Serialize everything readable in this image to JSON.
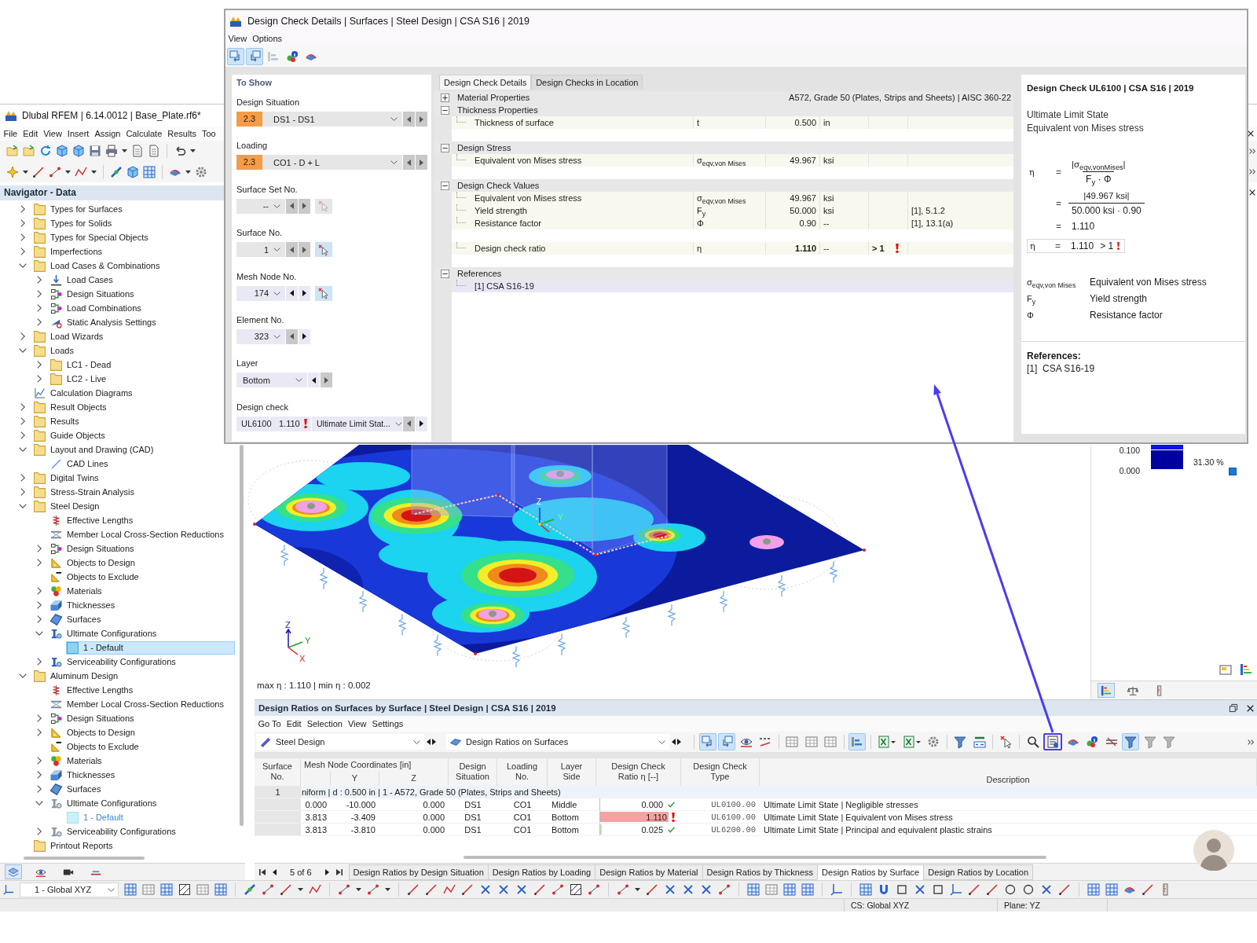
{
  "main_window": {
    "title": "Dlubal RFEM | 6.14.0012 | Base_Plate.rf6*",
    "menu": [
      "File",
      "Edit",
      "View",
      "Insert",
      "Assign",
      "Calculate",
      "Results",
      "Too"
    ]
  },
  "navigator": {
    "title": "Navigator - Data",
    "items": [
      {
        "label": "Types for Surfaces",
        "kind": "folder",
        "expanded": false,
        "selected": false
      },
      {
        "label": "Types for Solids",
        "kind": "folder",
        "expanded": false,
        "selected": false
      },
      {
        "label": "Types for Special Objects",
        "kind": "folder",
        "expanded": false,
        "selected": false
      },
      {
        "label": "Imperfections",
        "kind": "folder",
        "expanded": false,
        "selected": false
      },
      {
        "label": "Load Cases & Combinations",
        "kind": "folder",
        "expanded": true,
        "selected": false,
        "children": [
          {
            "label": "Load Cases",
            "kind": "load",
            "expanded": false,
            "selected": false
          },
          {
            "label": "Design Situations",
            "kind": "flow",
            "expanded": false,
            "selected": false
          },
          {
            "label": "Load Combinations",
            "kind": "flow",
            "expanded": false,
            "selected": false
          },
          {
            "label": "Static Analysis Settings",
            "kind": "settings",
            "expanded": false,
            "selected": false
          }
        ]
      },
      {
        "label": "Load Wizards",
        "kind": "folder",
        "expanded": false,
        "selected": false
      },
      {
        "label": "Loads",
        "kind": "folder",
        "expanded": true,
        "selected": false,
        "children": [
          {
            "label": "LC1 - Dead",
            "kind": "folder",
            "expanded": false,
            "selected": false
          },
          {
            "label": "LC2 - Live",
            "kind": "folder",
            "expanded": false,
            "selected": false
          }
        ]
      },
      {
        "label": "Calculation Diagrams",
        "kind": "diagram",
        "selected": false
      },
      {
        "label": "Result Objects",
        "kind": "folder",
        "expanded": false,
        "selected": false
      },
      {
        "label": "Results",
        "kind": "folder",
        "expanded": false,
        "selected": false
      },
      {
        "label": "Guide Objects",
        "kind": "folder",
        "expanded": false,
        "selected": false
      },
      {
        "label": "Layout and Drawing (CAD)",
        "kind": "folder",
        "expanded": true,
        "selected": false,
        "children": [
          {
            "label": "CAD Lines",
            "kind": "cadline",
            "selected": false
          }
        ]
      },
      {
        "label": "Digital Twins",
        "kind": "folder",
        "expanded": false,
        "selected": false
      },
      {
        "label": "Stress-Strain Analysis",
        "kind": "folder",
        "expanded": false,
        "selected": false
      },
      {
        "label": "Steel Design",
        "kind": "folder",
        "expanded": true,
        "selected": false,
        "children": [
          {
            "label": "Effective Lengths",
            "kind": "spring",
            "selected": false
          },
          {
            "label": "Member Local Cross-Section Reductions",
            "kind": "section",
            "selected": false
          },
          {
            "label": "Design Situations",
            "kind": "flow",
            "expanded": false,
            "selected": false
          },
          {
            "label": "Objects to Design",
            "kind": "setsquare",
            "expanded": false,
            "selected": false
          },
          {
            "label": "Objects to Exclude",
            "kind": "exclude",
            "selected": false
          },
          {
            "label": "Materials",
            "kind": "materials",
            "expanded": false,
            "selected": false
          },
          {
            "label": "Thicknesses",
            "kind": "slab",
            "expanded": false,
            "selected": false
          },
          {
            "label": "Surfaces",
            "kind": "plane",
            "expanded": false,
            "selected": false
          },
          {
            "label": "Ultimate Configurations",
            "kind": "config",
            "expanded": true,
            "selected": false,
            "children": [
              {
                "label": "1 - Default",
                "kind": "swatch",
                "selected": true
              }
            ]
          },
          {
            "label": "Serviceability Configurations",
            "kind": "config",
            "expanded": false,
            "selected": false
          }
        ]
      },
      {
        "label": "Aluminum Design",
        "kind": "folder",
        "expanded": true,
        "selected": false,
        "children": [
          {
            "label": "Effective Lengths",
            "kind": "spring",
            "selected": false
          },
          {
            "label": "Member Local Cross-Section Reductions",
            "kind": "section",
            "selected": false
          },
          {
            "label": "Design Situations",
            "kind": "flow",
            "expanded": false,
            "selected": false
          },
          {
            "label": "Objects to Design",
            "kind": "setsquare",
            "expanded": false,
            "selected": false
          },
          {
            "label": "Objects to Exclude",
            "kind": "exclude",
            "selected": false
          },
          {
            "label": "Materials",
            "kind": "materials",
            "expanded": false,
            "selected": false
          },
          {
            "label": "Thicknesses",
            "kind": "slab",
            "expanded": false,
            "selected": false
          },
          {
            "label": "Surfaces",
            "kind": "plane",
            "expanded": false,
            "selected": false
          },
          {
            "label": "Ultimate Configurations",
            "kind": "configgrey",
            "expanded": true,
            "selected": false,
            "children": [
              {
                "label": "1 - Default",
                "kind": "swatchpale",
                "selected": false
              }
            ]
          },
          {
            "label": "Serviceability Configurations",
            "kind": "configgrey",
            "expanded": false,
            "selected": false
          }
        ]
      },
      {
        "label": "Printout Reports",
        "kind": "folder",
        "selected": false
      }
    ],
    "tabs": [
      {
        "kind": "data",
        "selected": true
      },
      {
        "kind": "view",
        "selected": false
      },
      {
        "kind": "camera",
        "selected": false
      },
      {
        "kind": "guide",
        "selected": false
      }
    ]
  },
  "viewport": {
    "summary": "max η : 1.110 | min η : 0.002",
    "model_axes": [
      "Z",
      "Y"
    ],
    "corner_axes": [
      "Z",
      "Y",
      "X"
    ]
  },
  "legend": {
    "entries": [
      {
        "value": "0.100",
        "color": "#0a14e6"
      },
      {
        "value": "0.000",
        "color": "#0000a0",
        "share": "31.30 %"
      }
    ],
    "tabs": [
      {
        "kind": "scale",
        "selected": true
      },
      {
        "kind": "balance",
        "selected": false
      },
      {
        "kind": "ruler",
        "selected": false
      }
    ]
  },
  "results": {
    "title": "Design Ratios on Surfaces by Surface | Steel Design | CSA S16 | 2019",
    "menu": [
      "Go To",
      "Edit",
      "Selection",
      "View",
      "Settings"
    ],
    "module": "Steel Design",
    "table_type": "Design Ratios on Surfaces",
    "tools": [
      {
        "kind": "pickback",
        "pressed": true,
        "callout": false
      },
      {
        "kind": "pickfwd",
        "pressed": true,
        "callout": false
      },
      {
        "kind": "eye",
        "pressed": false,
        "callout": false
      },
      {
        "kind": "decimalx",
        "pressed": false,
        "callout": false
      },
      {
        "kind": "separator"
      },
      {
        "kind": "table",
        "pressed": false,
        "callout": false
      },
      {
        "kind": "table",
        "pressed": false,
        "callout": false
      },
      {
        "kind": "table",
        "pressed": false,
        "callout": false
      },
      {
        "kind": "separator"
      },
      {
        "kind": "bars",
        "pressed": true,
        "callout": false
      },
      {
        "kind": "separator"
      },
      {
        "kind": "excelmenu",
        "pressed": false,
        "callout": false
      },
      {
        "kind": "excelmenu",
        "pressed": false,
        "callout": false
      },
      {
        "kind": "gear",
        "pressed": false,
        "callout": false
      },
      {
        "kind": "separator"
      },
      {
        "kind": "filter",
        "pressed": false,
        "callout": false
      },
      {
        "kind": "decimal",
        "pressed": false,
        "callout": false
      },
      {
        "kind": "separator"
      },
      {
        "kind": "pickx",
        "pressed": false,
        "callout": false
      },
      {
        "kind": "separator"
      },
      {
        "kind": "search",
        "pressed": false,
        "callout": false
      },
      {
        "kind": "list",
        "pressed": false,
        "callout": true
      },
      {
        "kind": "plate",
        "pressed": false,
        "callout": false
      },
      {
        "kind": "info",
        "pressed": false,
        "callout": false
      },
      {
        "kind": "lines",
        "pressed": false,
        "callout": false
      },
      {
        "kind": "filter",
        "pressed": true,
        "callout": false
      },
      {
        "kind": "filtergrey",
        "pressed": false,
        "callout": false
      },
      {
        "kind": "filtergrey",
        "pressed": false,
        "callout": false
      }
    ],
    "columns": [
      {
        "lines": [
          "Surface",
          "No."
        ]
      },
      {
        "group": "Mesh Node Coordinates [in]"
      },
      {
        "sub": "Y"
      },
      {
        "sub": "Z"
      },
      {
        "lines": [
          "Design",
          "Situation"
        ]
      },
      {
        "lines": [
          "Loading",
          "No."
        ]
      },
      {
        "lines": [
          "Layer",
          "Side"
        ]
      },
      {
        "lines": [
          "Design Check",
          "Ratio η [--]"
        ]
      },
      {
        "lines": [
          "Design Check",
          "Type"
        ]
      },
      {
        "lines": [
          "Description"
        ]
      }
    ],
    "group_row": {
      "surface": "1",
      "text": "niform | d : 0.500 in | 1 - A572, Grade 50 (Plates, Strips and Sheets)"
    },
    "rows": [
      {
        "cells": [
          "",
          "0.000",
          "-10.000",
          "0.000",
          "DS1",
          "CO1",
          "Middle"
        ],
        "ratio": "0.000",
        "level": 0,
        "failed": false,
        "type": "UL0100.00",
        "description": "Ultimate Limit State | Negligible stresses"
      },
      {
        "cells": [
          "",
          "3.813",
          "-3.409",
          "0.000",
          "DS1",
          "CO1",
          "Bottom"
        ],
        "ratio": "1.110",
        "level": 1,
        "failed": true,
        "type": "UL6100.00",
        "description": "Ultimate Limit State | Equivalent von Mises stress"
      },
      {
        "cells": [
          "",
          "3.813",
          "-3.810",
          "0.000",
          "DS1",
          "CO1",
          "Bottom"
        ],
        "ratio": "0.025",
        "level": 0.025,
        "failed": false,
        "type": "UL6200.00",
        "description": "Ultimate Limit State | Principal and equivalent plastic strains"
      }
    ],
    "pager": "5 of 6",
    "tabs": [
      {
        "label": "Design Ratios by Design Situation",
        "selected": false
      },
      {
        "label": "Design Ratios by Loading",
        "selected": false
      },
      {
        "label": "Design Ratios by Material",
        "selected": false
      },
      {
        "label": "Design Ratios by Thickness",
        "selected": false
      },
      {
        "label": "Design Ratios by Surface",
        "selected": true
      },
      {
        "label": "Design Ratios by Location",
        "selected": false
      }
    ]
  },
  "coordinate_system": "1 - Global XYZ",
  "status_bar": [
    "CS: Global XYZ",
    "Plane: YZ"
  ],
  "dialog": {
    "title": "Design Check Details | Surfaces | Steel Design | CSA S16 | 2019",
    "menu": [
      "View",
      "Options"
    ],
    "tools": [
      {
        "kind": "pickback",
        "pressed": true,
        "disabled": false
      },
      {
        "kind": "pickfwd",
        "pressed": true,
        "disabled": false
      },
      {
        "kind": "bars",
        "pressed": false,
        "disabled": true
      },
      {
        "kind": "info",
        "pressed": false,
        "disabled": false
      },
      {
        "kind": "plate",
        "pressed": false,
        "disabled": false
      }
    ],
    "to_show": {
      "title": "To Show",
      "fields": [
        {
          "label": "Design Situation",
          "kind": "indexed",
          "badge": "2.3",
          "value": "DS1 - DS1",
          "disabled": true,
          "prev_disabled": true,
          "next_disabled": true
        },
        {
          "label": "Loading",
          "kind": "indexed",
          "badge": "2.3",
          "value": "CO1 - D + L",
          "disabled": true,
          "prev_disabled": true,
          "next_disabled": true
        },
        {
          "label": "Surface Set No.",
          "kind": "number",
          "value": "--",
          "disabled": true,
          "prev_disabled": true,
          "next_disabled": true,
          "pick_active": false
        },
        {
          "label": "Surface No.",
          "kind": "number",
          "value": "1",
          "disabled": true,
          "prev_disabled": true,
          "next_disabled": true,
          "pick_active": true
        },
        {
          "label": "Mesh Node No.",
          "kind": "number",
          "value": "174",
          "disabled": false,
          "prev_disabled": false,
          "next_disabled": false,
          "pick_active": true
        },
        {
          "label": "Element No.",
          "kind": "number",
          "value": "323",
          "disabled": false,
          "prev_disabled": true,
          "next_disabled": false
        },
        {
          "label": "Layer",
          "kind": "text",
          "value": "Bottom",
          "disabled": false,
          "prev_disabled": false,
          "next_disabled": true
        },
        {
          "label": "Design check",
          "kind": "check",
          "code": "UL6100",
          "ratio": "1.110",
          "failed": true,
          "value": "Ultimate Limit Stat...",
          "disabled": false,
          "prev_disabled": true,
          "next_disabled": false
        }
      ]
    },
    "tabs": [
      {
        "label": "Design Check Details",
        "selected": true
      },
      {
        "label": "Design Checks in Location",
        "selected": false
      }
    ],
    "sections": [
      {
        "title": "Material Properties",
        "expanded": false,
        "info": "A572, Grade 50 (Plates, Strips and Sheets) | AISC 360-22"
      },
      {
        "title": "Thickness Properties",
        "expanded": true,
        "rows": [
          {
            "kind": "value",
            "name": "Thickness of surface",
            "symbol": "t",
            "value": "0.500",
            "unit": "in"
          },
          {
            "kind": "blank"
          }
        ]
      },
      {
        "title": "Design Stress",
        "expanded": true,
        "rows": [
          {
            "kind": "value",
            "name": "Equivalent von Mises stress",
            "symbol": "σ$_{eqv,von Mises}$",
            "value": "49.967",
            "unit": "ksi"
          },
          {
            "kind": "blank"
          }
        ]
      },
      {
        "title": "Design Check Values",
        "expanded": true,
        "rows": [
          {
            "kind": "value",
            "name": "Equivalent von Mises stress",
            "symbol": "σ$_{eqv,von Mises}$",
            "value": "49.967",
            "unit": "ksi"
          },
          {
            "kind": "value",
            "name": "Yield strength",
            "symbol": "F$_{y}$",
            "value": "50.000",
            "unit": "ksi",
            "reference": "[1], 5.1.2"
          },
          {
            "kind": "value",
            "name": "Resistance factor",
            "symbol": "Φ",
            "value": "0.90",
            "unit": "--",
            "reference": "[1], 13.1(a)"
          },
          {
            "kind": "blank"
          },
          {
            "kind": "ratio",
            "name": "Design check ratio",
            "symbol": "η",
            "value": "1.110",
            "unit": "--",
            "limit": "> 1",
            "failed": true
          },
          {
            "kind": "blank"
          }
        ]
      },
      {
        "title": "References",
        "expanded": true,
        "rows": [
          {
            "kind": "reference",
            "name": "[1]  CSA S16-19"
          }
        ]
      }
    ],
    "info": {
      "title": "Design Check UL6100 | CSA S16 | 2019",
      "lines": [
        "Ultimate Limit State",
        "Equivalent von Mises stress"
      ],
      "formula": {
        "symbol": "η",
        "steps": [
          {
            "kind": "fraction",
            "eq": "=",
            "numerator": "|σ$_{eqv,vonMises}$|",
            "denominator": "F$_{y}$ · Φ"
          },
          {
            "kind": "fraction",
            "eq": "=",
            "numerator": "|49.967 ksi|",
            "denominator": "50.000 ksi · 0.90"
          },
          {
            "kind": "value",
            "eq": "=",
            "value": "1.110"
          }
        ],
        "result": {
          "symbol": "η",
          "eq": "=",
          "value": "1.110",
          "limit": "> 1",
          "failed": true
        }
      },
      "symbols": [
        {
          "symbol": "σ$_{eqv,von Mises}$",
          "text": "Equivalent von Mises stress"
        },
        {
          "symbol": "F$_{y}$",
          "text": "Yield strength"
        },
        {
          "symbol": "Φ",
          "text": "Resistance factor"
        }
      ],
      "references_title": "References:",
      "references": [
        "[1]  CSA S16-19"
      ]
    }
  }
}
